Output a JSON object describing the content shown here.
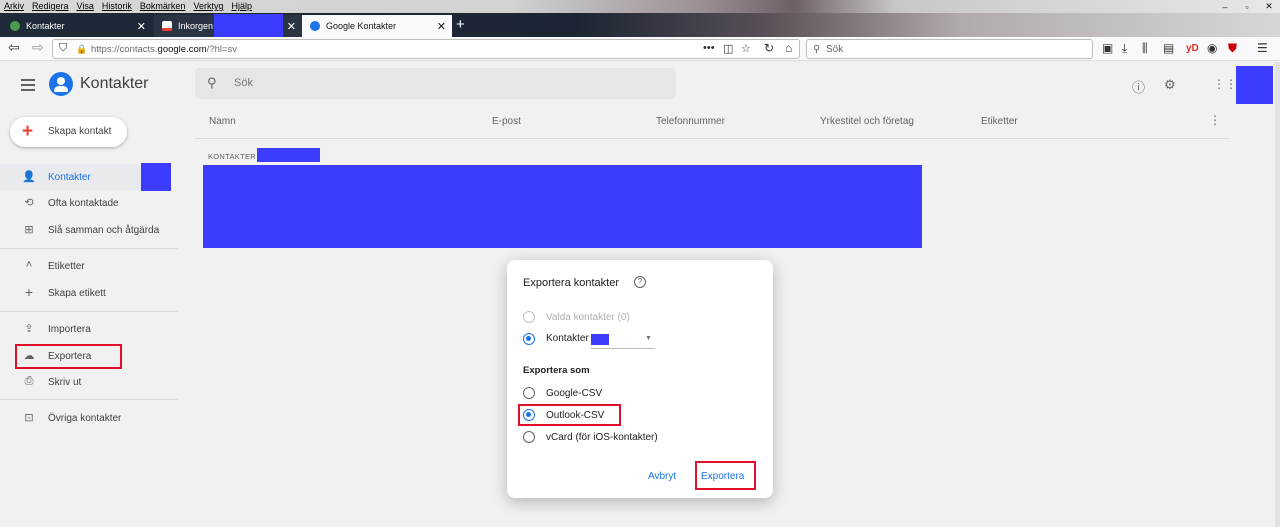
{
  "browser": {
    "menu": [
      "Arkiv",
      "Redigera",
      "Visa",
      "Historik",
      "Bokmärken",
      "Verktyg",
      "Hjälp"
    ],
    "tabs": [
      {
        "label": "Kontakter",
        "favicon_color": "#4a9c4a"
      },
      {
        "label": "Inkorgen -",
        "favicon_color": "#ea4335"
      },
      {
        "label": "Google Kontakter",
        "favicon_color": "#1a73e8"
      }
    ],
    "url_prefix": "https://contacts.",
    "url_domain": "google.com",
    "url_suffix": "/?hl=sv",
    "search_placeholder": "Sök"
  },
  "app": {
    "title": "Kontakter",
    "search_placeholder": "Sök",
    "create_button": "Skapa kontakt"
  },
  "sidebar": {
    "items": [
      {
        "label": "Kontakter",
        "icon": "person-icon"
      },
      {
        "label": "Ofta kontaktade",
        "icon": "history-icon"
      },
      {
        "label": "Slå samman och åtgärda",
        "icon": "merge-icon"
      },
      {
        "label": "Etiketter",
        "icon": "chevron-up-icon"
      },
      {
        "label": "Skapa etikett",
        "icon": "plus-icon"
      },
      {
        "label": "Importera",
        "icon": "upload-icon"
      },
      {
        "label": "Exportera",
        "icon": "cloud-download-icon"
      },
      {
        "label": "Skriv ut",
        "icon": "printer-icon"
      },
      {
        "label": "Övriga kontakter",
        "icon": "other-contacts-icon"
      }
    ]
  },
  "table": {
    "columns": [
      "Namn",
      "E-post",
      "Telefonnummer",
      "Yrkestitel och företag",
      "Etiketter"
    ],
    "section_label": "KONTAKTER"
  },
  "dialog": {
    "title": "Exportera kontakter",
    "source_options": [
      {
        "label": "Valda kontakter (0)",
        "state": "disabled"
      },
      {
        "label": "Kontakter",
        "state": "checked"
      }
    ],
    "format_heading": "Exportera som",
    "format_options": [
      {
        "label": "Google-CSV",
        "state": "unchecked"
      },
      {
        "label": "Outlook-CSV",
        "state": "checked"
      },
      {
        "label": "vCard (för iOS-kontakter)",
        "state": "unchecked"
      }
    ],
    "cancel_label": "Avbryt",
    "export_label": "Exportera"
  },
  "colors": {
    "accent": "#1a73e8",
    "highlight_box": "#e0102a",
    "redaction": "#3c3cff"
  }
}
